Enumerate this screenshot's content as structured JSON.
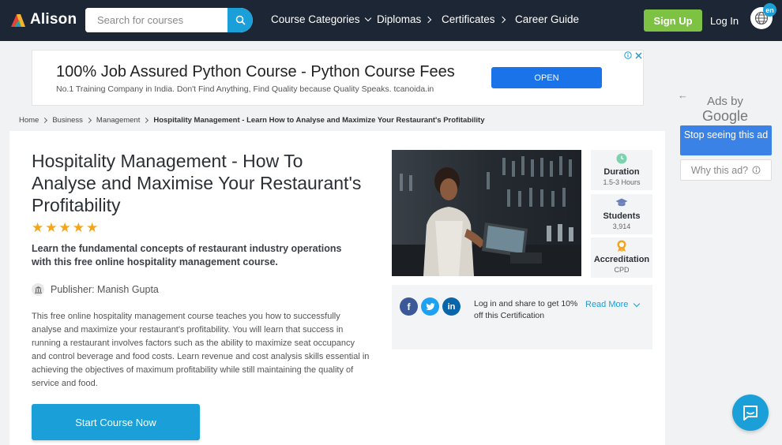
{
  "header": {
    "logo_text": "Alison",
    "search_placeholder": "Search for courses",
    "nav": [
      "Course Categories",
      "Diplomas",
      "Certificates",
      "Career Guide"
    ],
    "signup_label": "Sign Up",
    "login_label": "Log In",
    "language": "en"
  },
  "top_ad": {
    "title": "100% Job Assured Python Course - Python Course Fees",
    "description": "No.1 Training Company in India. Don't Find Anything, Find Quality because Quality Speaks. tcanoida.in",
    "button_label": "OPEN"
  },
  "side_ad": {
    "ads_by": "Ads by",
    "google": "Google",
    "stop_label": "Stop seeing this ad",
    "why_label": "Why this ad?"
  },
  "breadcrumb": [
    "Home",
    "Business",
    "Management",
    "Hospitality Management - Learn How to Analyse and Maximize Your Restaurant's Profitability"
  ],
  "course": {
    "title": "Hospitality Management - How To Analyse and Maximise Your Restaurant's Profitability",
    "rating_stars": 5,
    "lead": "Learn the fundamental concepts of restaurant industry operations with this free online hospitality management course.",
    "publisher": "Publisher: Manish Gupta",
    "description": "This free online hospitality management course teaches you how to successfully analyse and maximize your restaurant's profitability. You will learn that success in running a restaurant involves factors such as the ability to maximize seat occupancy and control beverage and food costs. Learn revenue and cost analysis skills essential in achieving the objectives of maximum profitability while still maintaining the quality of service and food.",
    "start_label": "Start Course Now"
  },
  "stats": [
    {
      "label": "Duration",
      "value": "1.5-3 Hours"
    },
    {
      "label": "Students",
      "value": "3,914"
    },
    {
      "label": "Accreditation",
      "value": "CPD"
    }
  ],
  "share": {
    "text": "Log in and share to get 10% off this Certification",
    "read_more": "Read More"
  },
  "colors": {
    "nav_bg": "#1d2635",
    "accent": "#1a9fd8",
    "signup": "#7dc242",
    "stars": "#f4a51c"
  }
}
